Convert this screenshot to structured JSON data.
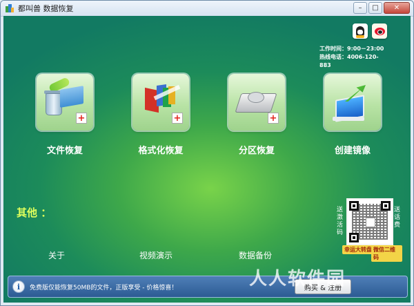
{
  "window": {
    "title": "都叫兽 数据恢复"
  },
  "contact": {
    "work_hours": "工作时间：9:00－23:00",
    "hotline": "热线电话：4006-120-883"
  },
  "social": {
    "qq": "qq-icon",
    "weibo": "weibo-icon"
  },
  "features": [
    {
      "label": "文件恢复",
      "icon": "file-recovery-icon"
    },
    {
      "label": "格式化恢复",
      "icon": "format-recovery-icon"
    },
    {
      "label": "分区恢复",
      "icon": "partition-recovery-icon"
    },
    {
      "label": "创建镜像",
      "icon": "create-image-icon"
    }
  ],
  "others": {
    "title": "其他 ：",
    "links": [
      "关于",
      "视频演示",
      "数据备份"
    ]
  },
  "qr": {
    "left_text": "送激活码",
    "right_text": "送话费",
    "tag_left": "幸运大转盘",
    "tag_right": "微信二维码"
  },
  "notice": {
    "text": "免费版仅能恢复50MB的文件，正版享受 - 价格惊喜！",
    "buy_label": "购买 & 注册"
  },
  "watermark": "人人软件园",
  "colors": {
    "accent_green": "#3ea84a",
    "notice_blue": "#2c5b93",
    "others_yellow": "#dfff5c"
  }
}
